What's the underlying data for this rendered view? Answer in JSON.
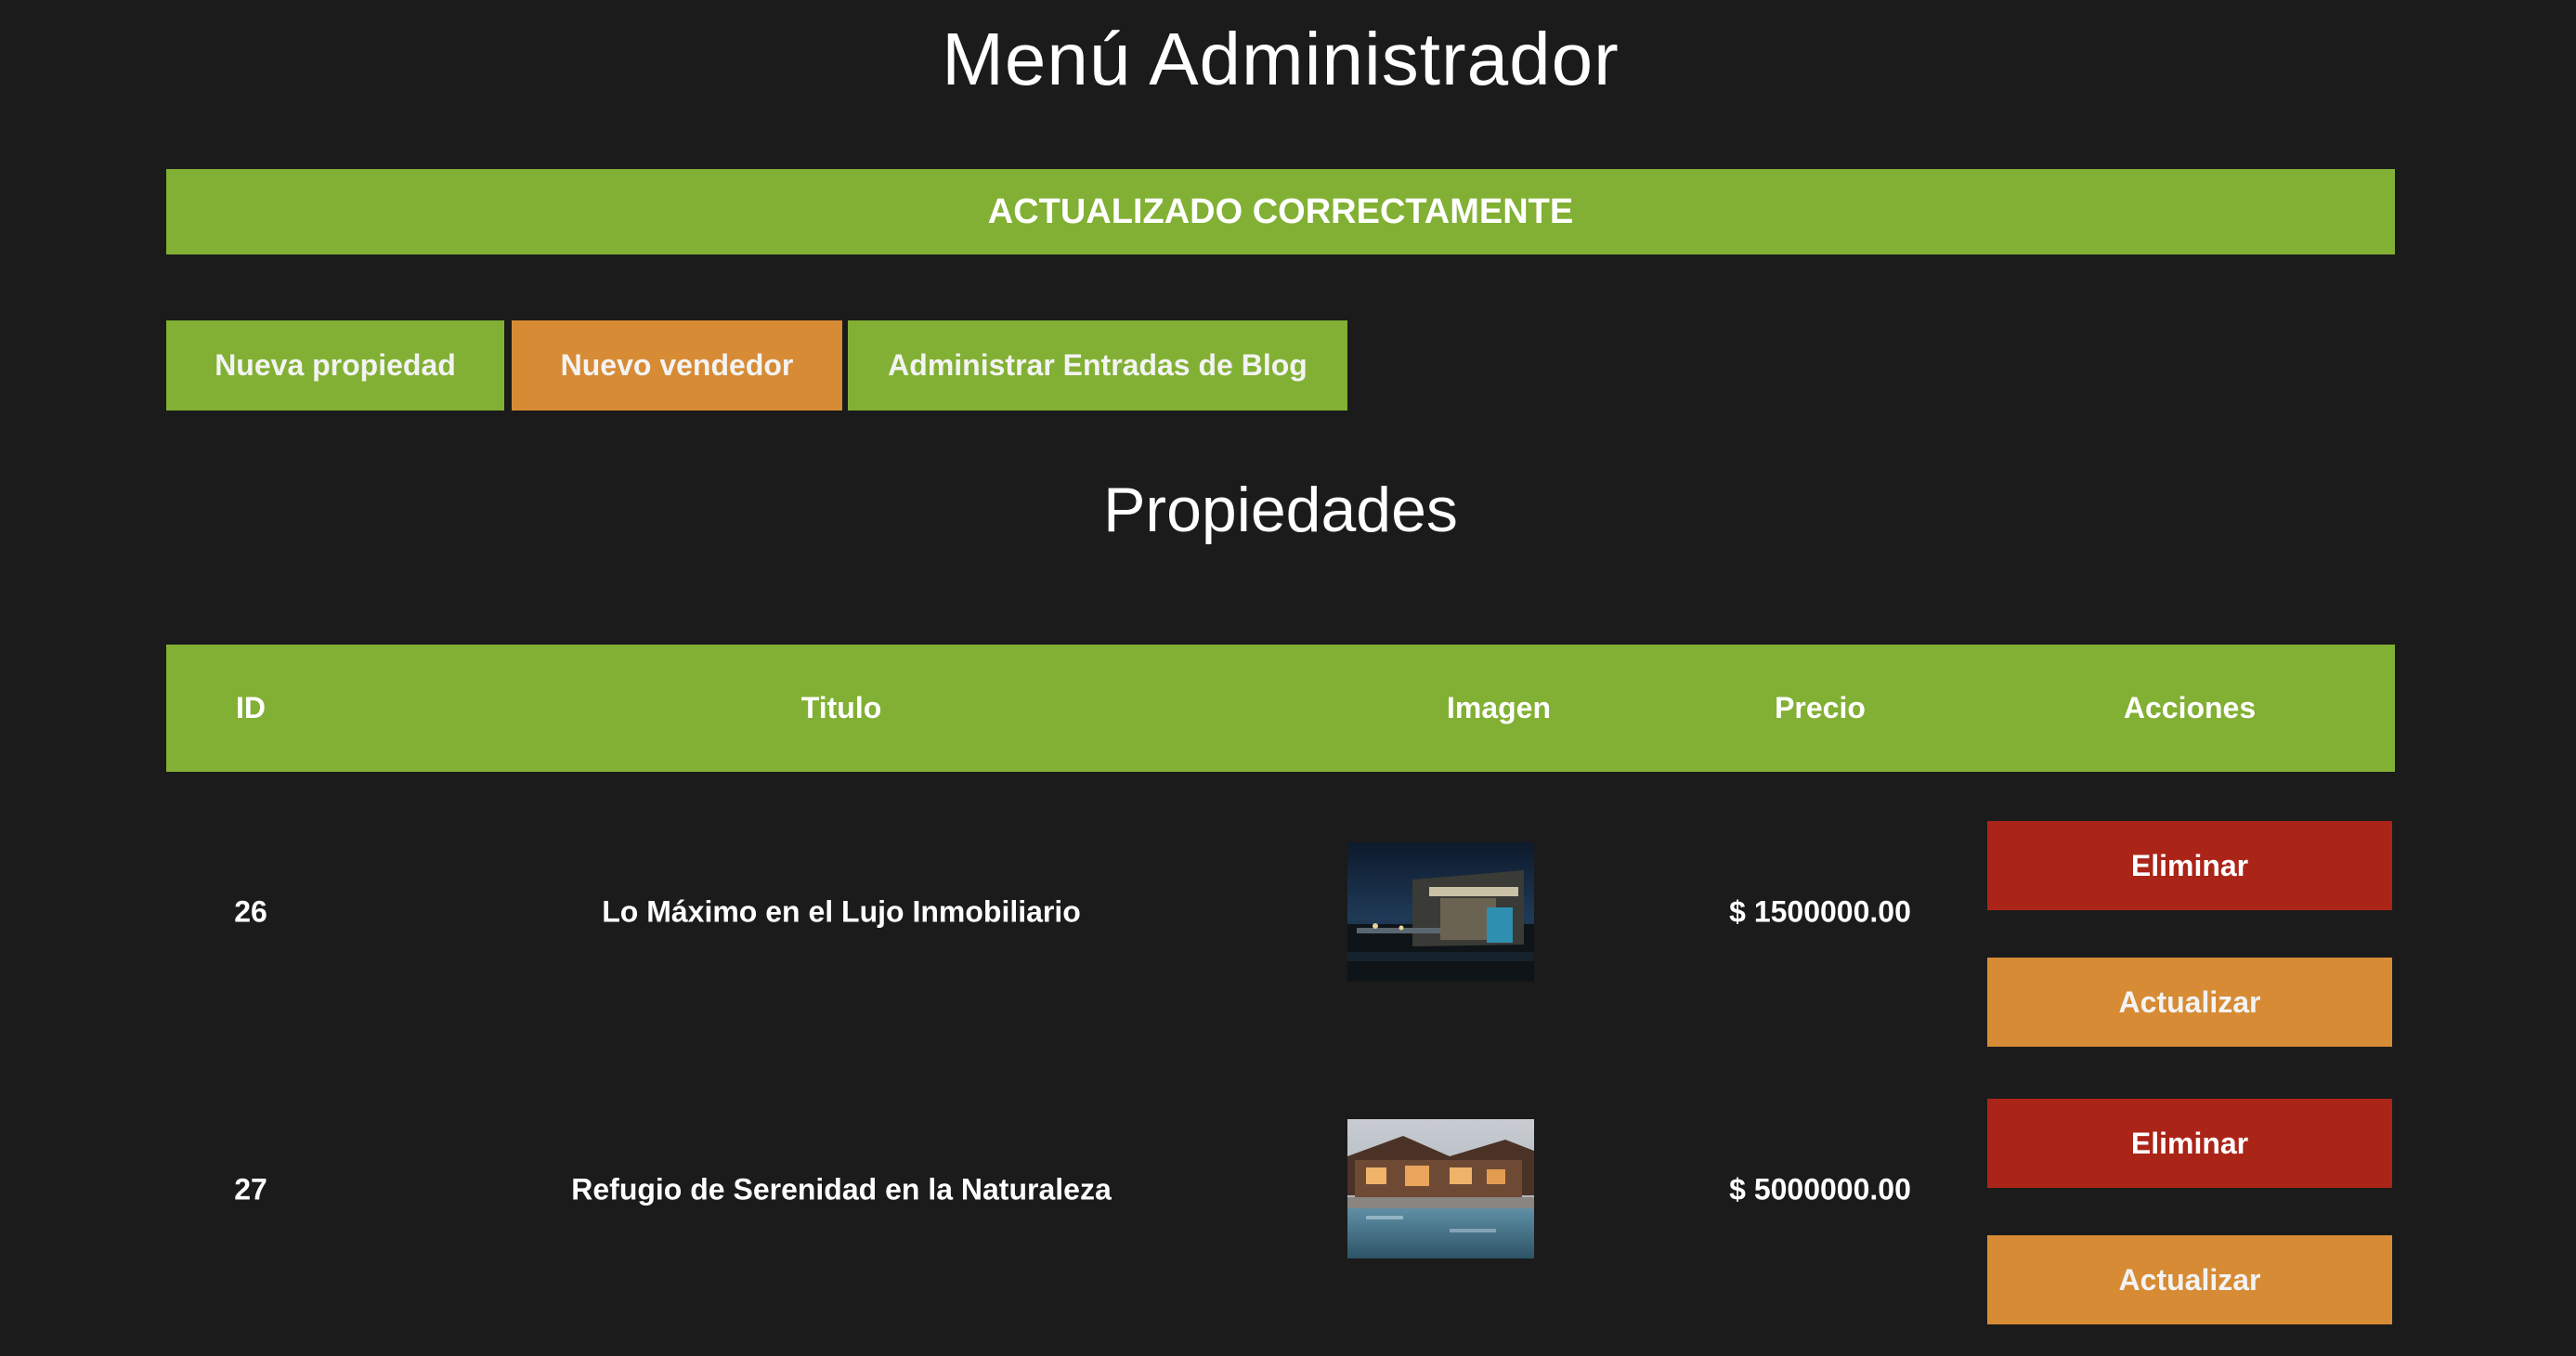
{
  "page": {
    "title": "Menú Administrador",
    "alert": "ACTUALIZADO CORRECTAMENTE",
    "section_title": "Propiedades"
  },
  "nav": {
    "new_property": "Nueva propiedad",
    "new_seller": "Nuevo vendedor",
    "manage_blog": "Administrar Entradas de Blog"
  },
  "table": {
    "headers": {
      "id": "ID",
      "title": "Titulo",
      "image": "Imagen",
      "price": "Precio",
      "actions": "Acciones"
    },
    "rows": [
      {
        "id": "26",
        "title": "Lo Máximo en el Lujo Inmobiliario",
        "price": "$ 1500000.00",
        "delete_label": "Eliminar",
        "update_label": "Actualizar"
      },
      {
        "id": "27",
        "title": "Refugio de Serenidad en la Naturaleza",
        "price": "$ 5000000.00",
        "delete_label": "Eliminar",
        "update_label": "Actualizar"
      }
    ]
  },
  "colors": {
    "background": "#1b1b1b",
    "green": "#82b034",
    "orange": "#d78b35",
    "red": "#ab2418"
  }
}
